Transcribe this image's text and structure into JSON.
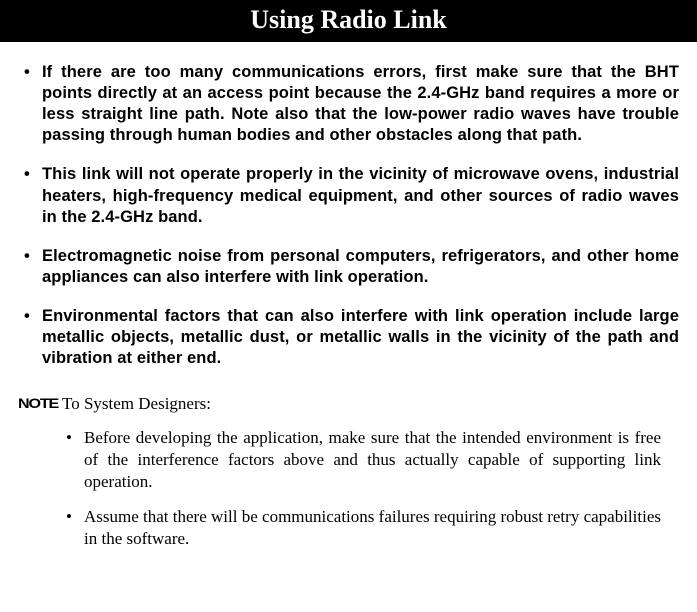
{
  "header": {
    "title": "Using Radio Link"
  },
  "bullets": [
    "If there are too many communications errors, first make sure that the BHT points directly at an access point because the 2.4-GHz band requires a more or less straight line path. Note also that the low-power radio waves have trouble passing through human bodies and other obstacles along that path.",
    "This link will not operate properly in the vicinity of microwave ovens, industrial heaters, high-frequency medical equipment, and other sources of radio waves in the 2.4-GHz band.",
    "Electromagnetic noise from personal computers, refrigerators, and other home appliances can also interfere with link operation.",
    "Environmental factors that can also interfere with link operation include large metallic objects, metallic dust, or metallic walls in the vicinity of the path and vibration at either end."
  ],
  "note": {
    "label": "NOTE",
    "lead": "To System Designers:",
    "items": [
      "Before developing the application, make sure that the intended environment is free of the interference factors above and thus actually capable of supporting link operation.",
      "Assume that there will be communications failures requiring robust retry capabilities in the software."
    ]
  }
}
